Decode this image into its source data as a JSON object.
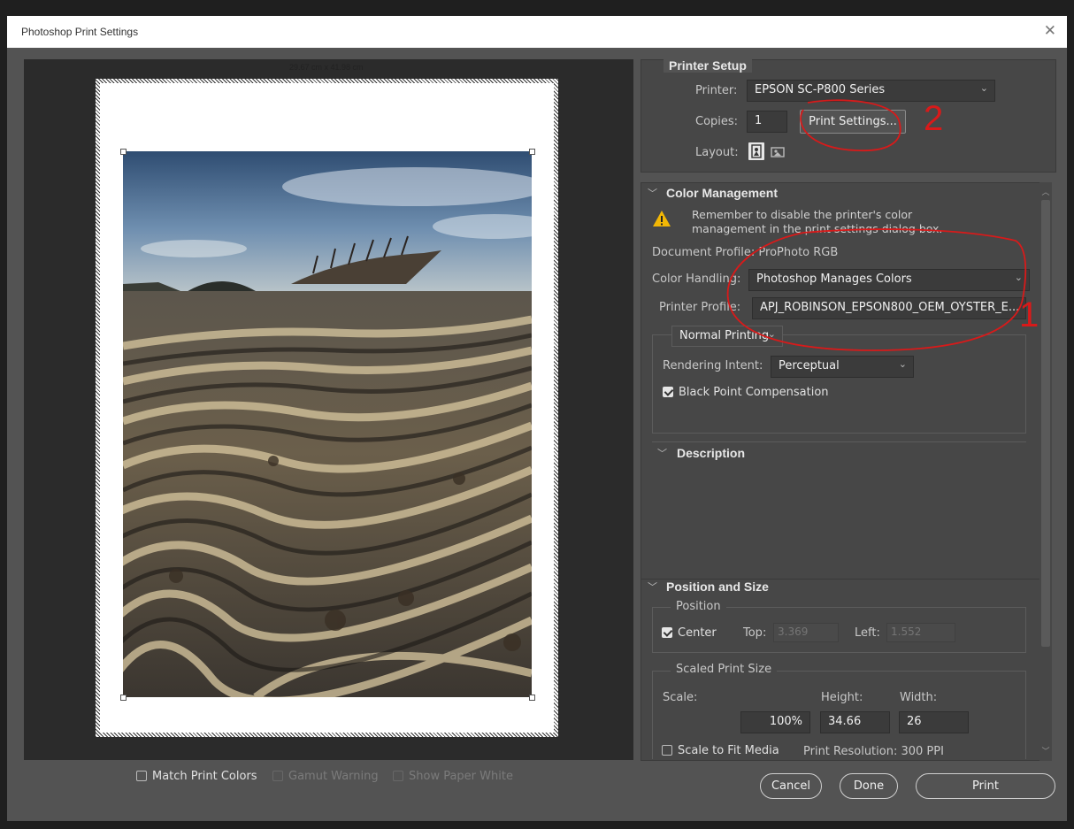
{
  "window": {
    "title": "Photoshop Print Settings",
    "close_glyph": "✕"
  },
  "preview": {
    "dimensions": "29.67 cm x 41.98 cm"
  },
  "bottom_bar": {
    "match_print_colors": "Match Print Colors",
    "gamut_warning": "Gamut Warning",
    "show_paper_white": "Show Paper White",
    "match_print_colors_checked": false
  },
  "printer_setup": {
    "title": "Printer Setup",
    "printer_label": "Printer:",
    "printer_value": "EPSON SC-P800 Series",
    "copies_label": "Copies:",
    "copies_value": "1",
    "print_settings_button": "Print Settings...",
    "layout_label": "Layout:"
  },
  "color_management": {
    "title": "Color Management",
    "warning_line1": "Remember to disable the printer's color",
    "warning_line2": "management in the print settings dialog box.",
    "document_profile": "Document Profile: ProPhoto RGB",
    "color_handling_label": "Color Handling:",
    "color_handling_value": "Photoshop Manages Colors",
    "printer_profile_label": "Printer Profile:",
    "printer_profile_value": "APJ_ROBINSON_EPSON800_OEM_OYSTER_E...",
    "normal_printing": "Normal Printing",
    "rendering_intent_label": "Rendering Intent:",
    "rendering_intent_value": "Perceptual",
    "black_point_compensation": "Black Point Compensation",
    "black_point_checked": true
  },
  "description": {
    "title": "Description"
  },
  "position_and_size": {
    "title": "Position and Size",
    "position_group": "Position",
    "center_label": "Center",
    "center_checked": true,
    "top_label": "Top:",
    "top_value": "3.369",
    "left_label": "Left:",
    "left_value": "1.552",
    "scaled_group": "Scaled Print Size",
    "scale_label": "Scale:",
    "height_label": "Height:",
    "width_label": "Width:",
    "scale_value": "100%",
    "height_value": "34.66",
    "width_value": "26",
    "scale_to_fit": "Scale to Fit Media",
    "print_resolution": "Print Resolution: 300 PPI"
  },
  "buttons": {
    "cancel": "Cancel",
    "done": "Done",
    "print": "Print"
  },
  "annotations": {
    "one": "1",
    "two": "2"
  },
  "colors": {
    "annotation": "#d81a1a",
    "dialog_bg": "#535353",
    "panel_bg": "#474747"
  }
}
